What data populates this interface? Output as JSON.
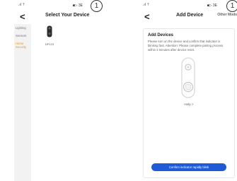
{
  "circle_markers": [
    "1",
    "1"
  ],
  "screen1": {
    "status": {
      "signal": ".ıl ⇡",
      "battery": "■▷ 3E"
    },
    "title": "Select Your Device",
    "sidebar": [
      {
        "label": "Lighting",
        "active": false
      },
      {
        "label": "Sensors",
        "active": false
      },
      {
        "label": "Home Security",
        "active": true
      }
    ],
    "device": {
      "label": "DP123"
    }
  },
  "screen2": {
    "status": {
      "signal": ".ıl ⇡",
      "battery": "■▷ 3E"
    },
    "title": "Add Device",
    "other_mode": "Other Mode",
    "card": {
      "title": "Add Devices",
      "text": "Please turn on the device and confirm that indicator is blinking fast. Attention: Please complete pairing process within 3 minutes after device reset.",
      "help": "Help >",
      "confirm_label": "Confirm indicator rapidly blink"
    }
  }
}
